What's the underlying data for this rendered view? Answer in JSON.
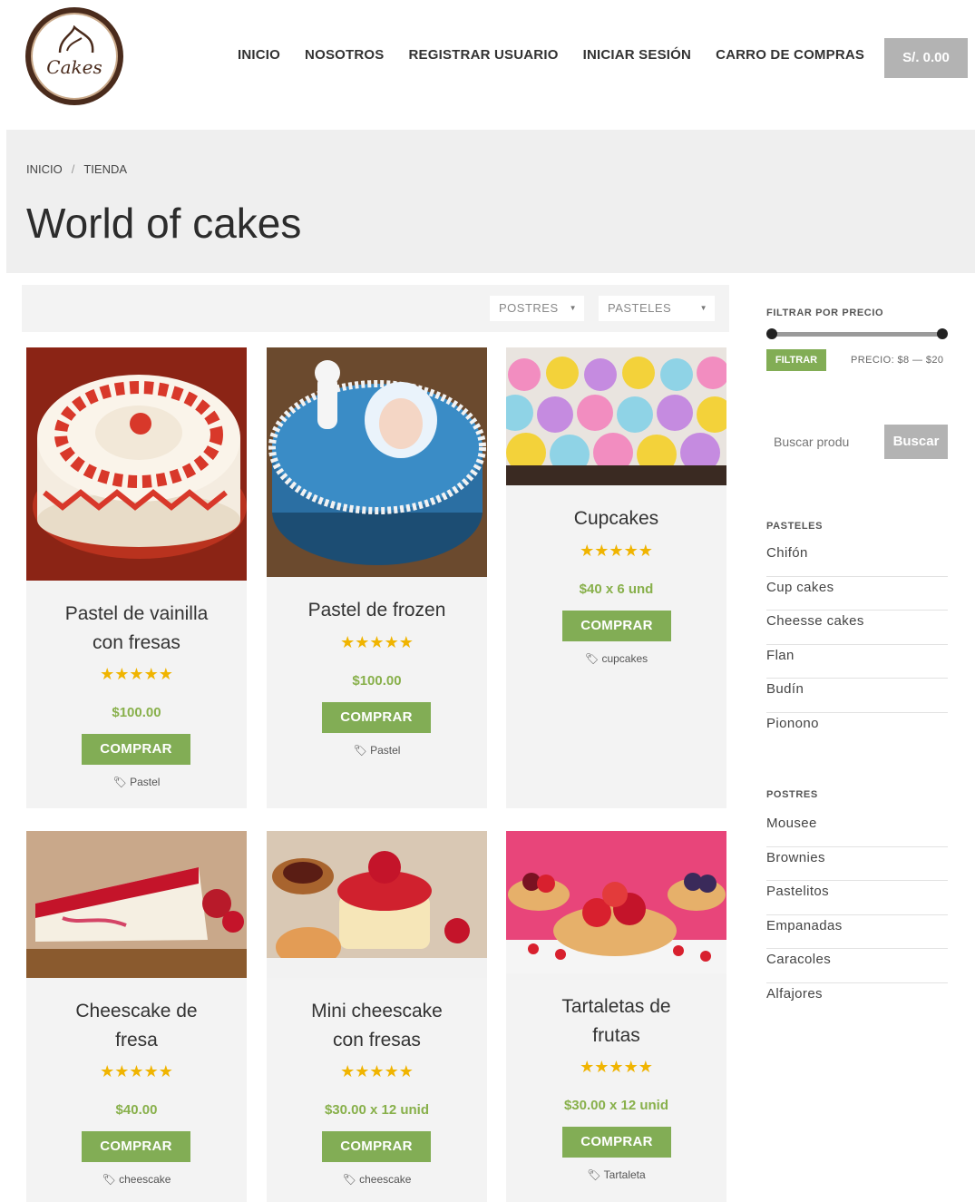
{
  "header": {
    "logo_text": "Cakes",
    "nav": [
      "INICIO",
      "NOSOTROS",
      "REGISTRAR USUARIO",
      "INICIAR SESIÓN",
      "CARRO DE COMPRAS"
    ],
    "cart_total": "S/. 0.00"
  },
  "breadcrumb": {
    "home": "INICIO",
    "separator": "/",
    "current": "TIENDA"
  },
  "page_title": "World of cakes",
  "filters": {
    "postres_select": "POSTRES",
    "pasteles_select": "PASTELES"
  },
  "products": [
    {
      "name_line1": "Pastel de vainilla",
      "name_line2": "con fresas",
      "stars": "★★★★★",
      "rating": 5,
      "price": "$100.00",
      "button": "COMPRAR",
      "tag": "Pastel"
    },
    {
      "name_line1": "Pastel de frozen",
      "name_line2": "",
      "stars": "★★★★★",
      "rating": 5,
      "price": "$100.00",
      "button": "COMPRAR",
      "tag": "Pastel"
    },
    {
      "name_line1": "Cupcakes",
      "name_line2": "",
      "stars": "★★★★★",
      "rating": 5,
      "price": "$40 x 6 und",
      "button": "COMPRAR",
      "tag": "cupcakes"
    },
    {
      "name_line1": "Cheescake de",
      "name_line2": "fresa",
      "stars": "★★★★★",
      "rating": 5,
      "price": "$40.00",
      "button": "COMPRAR",
      "tag": "cheescake"
    },
    {
      "name_line1": "Mini cheescake",
      "name_line2": "con fresas",
      "stars": "★★★★★",
      "rating": 5,
      "price": "$30.00 x 12 unid",
      "button": "COMPRAR",
      "tag": "cheescake"
    },
    {
      "name_line1": "Tartaletas de",
      "name_line2": "frutas",
      "stars": "★★★★★",
      "rating": 5,
      "price": "$30.00 x 12 unid",
      "button": "COMPRAR",
      "tag": "Tartaleta"
    }
  ],
  "sidebar": {
    "price_filter_title": "FILTRAR POR PRECIO",
    "filter_button": "FILTRAR",
    "price_range": "PRECIO: $8 — $20",
    "search_placeholder": "Buscar produ",
    "search_button": "Buscar",
    "pasteles_title": "PASTELES",
    "pasteles": [
      "Chifón",
      "Cup cakes",
      "Cheesse cakes",
      "Flan",
      "Budín",
      "Pionono"
    ],
    "postres_title": "POSTRES",
    "postres": [
      "Mousee",
      "Brownies",
      "Pastelitos",
      "Empanadas",
      "Caracoles",
      "Alfajores"
    ]
  },
  "colors": {
    "accent_green": "#82ad55",
    "price_green": "#88b04b",
    "star_gold": "#f0b400",
    "button_gray": "#b3b3b3"
  }
}
